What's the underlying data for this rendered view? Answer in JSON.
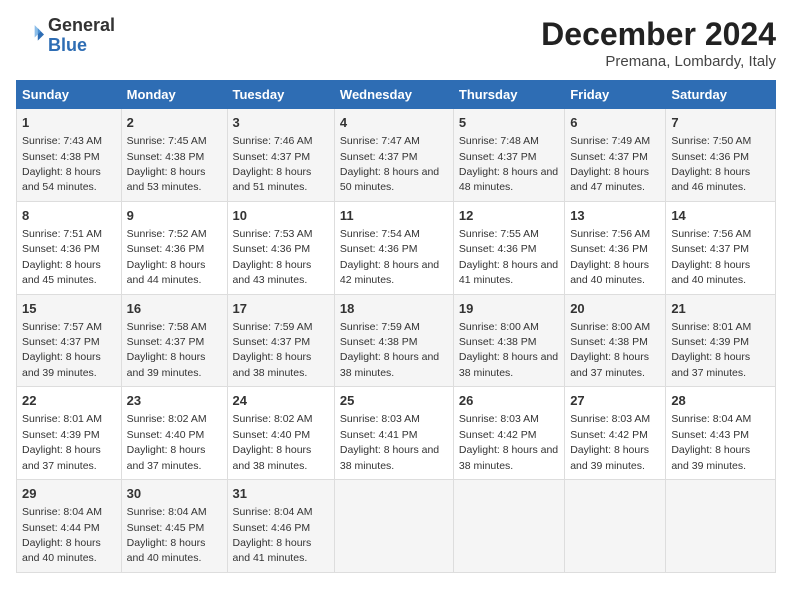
{
  "header": {
    "logo_general": "General",
    "logo_blue": "Blue",
    "month_title": "December 2024",
    "location": "Premana, Lombardy, Italy"
  },
  "weekdays": [
    "Sunday",
    "Monday",
    "Tuesday",
    "Wednesday",
    "Thursday",
    "Friday",
    "Saturday"
  ],
  "weeks": [
    [
      {
        "day": "1",
        "sunrise": "Sunrise: 7:43 AM",
        "sunset": "Sunset: 4:38 PM",
        "daylight": "Daylight: 8 hours and 54 minutes."
      },
      {
        "day": "2",
        "sunrise": "Sunrise: 7:45 AM",
        "sunset": "Sunset: 4:38 PM",
        "daylight": "Daylight: 8 hours and 53 minutes."
      },
      {
        "day": "3",
        "sunrise": "Sunrise: 7:46 AM",
        "sunset": "Sunset: 4:37 PM",
        "daylight": "Daylight: 8 hours and 51 minutes."
      },
      {
        "day": "4",
        "sunrise": "Sunrise: 7:47 AM",
        "sunset": "Sunset: 4:37 PM",
        "daylight": "Daylight: 8 hours and 50 minutes."
      },
      {
        "day": "5",
        "sunrise": "Sunrise: 7:48 AM",
        "sunset": "Sunset: 4:37 PM",
        "daylight": "Daylight: 8 hours and 48 minutes."
      },
      {
        "day": "6",
        "sunrise": "Sunrise: 7:49 AM",
        "sunset": "Sunset: 4:37 PM",
        "daylight": "Daylight: 8 hours and 47 minutes."
      },
      {
        "day": "7",
        "sunrise": "Sunrise: 7:50 AM",
        "sunset": "Sunset: 4:36 PM",
        "daylight": "Daylight: 8 hours and 46 minutes."
      }
    ],
    [
      {
        "day": "8",
        "sunrise": "Sunrise: 7:51 AM",
        "sunset": "Sunset: 4:36 PM",
        "daylight": "Daylight: 8 hours and 45 minutes."
      },
      {
        "day": "9",
        "sunrise": "Sunrise: 7:52 AM",
        "sunset": "Sunset: 4:36 PM",
        "daylight": "Daylight: 8 hours and 44 minutes."
      },
      {
        "day": "10",
        "sunrise": "Sunrise: 7:53 AM",
        "sunset": "Sunset: 4:36 PM",
        "daylight": "Daylight: 8 hours and 43 minutes."
      },
      {
        "day": "11",
        "sunrise": "Sunrise: 7:54 AM",
        "sunset": "Sunset: 4:36 PM",
        "daylight": "Daylight: 8 hours and 42 minutes."
      },
      {
        "day": "12",
        "sunrise": "Sunrise: 7:55 AM",
        "sunset": "Sunset: 4:36 PM",
        "daylight": "Daylight: 8 hours and 41 minutes."
      },
      {
        "day": "13",
        "sunrise": "Sunrise: 7:56 AM",
        "sunset": "Sunset: 4:36 PM",
        "daylight": "Daylight: 8 hours and 40 minutes."
      },
      {
        "day": "14",
        "sunrise": "Sunrise: 7:56 AM",
        "sunset": "Sunset: 4:37 PM",
        "daylight": "Daylight: 8 hours and 40 minutes."
      }
    ],
    [
      {
        "day": "15",
        "sunrise": "Sunrise: 7:57 AM",
        "sunset": "Sunset: 4:37 PM",
        "daylight": "Daylight: 8 hours and 39 minutes."
      },
      {
        "day": "16",
        "sunrise": "Sunrise: 7:58 AM",
        "sunset": "Sunset: 4:37 PM",
        "daylight": "Daylight: 8 hours and 39 minutes."
      },
      {
        "day": "17",
        "sunrise": "Sunrise: 7:59 AM",
        "sunset": "Sunset: 4:37 PM",
        "daylight": "Daylight: 8 hours and 38 minutes."
      },
      {
        "day": "18",
        "sunrise": "Sunrise: 7:59 AM",
        "sunset": "Sunset: 4:38 PM",
        "daylight": "Daylight: 8 hours and 38 minutes."
      },
      {
        "day": "19",
        "sunrise": "Sunrise: 8:00 AM",
        "sunset": "Sunset: 4:38 PM",
        "daylight": "Daylight: 8 hours and 38 minutes."
      },
      {
        "day": "20",
        "sunrise": "Sunrise: 8:00 AM",
        "sunset": "Sunset: 4:38 PM",
        "daylight": "Daylight: 8 hours and 37 minutes."
      },
      {
        "day": "21",
        "sunrise": "Sunrise: 8:01 AM",
        "sunset": "Sunset: 4:39 PM",
        "daylight": "Daylight: 8 hours and 37 minutes."
      }
    ],
    [
      {
        "day": "22",
        "sunrise": "Sunrise: 8:01 AM",
        "sunset": "Sunset: 4:39 PM",
        "daylight": "Daylight: 8 hours and 37 minutes."
      },
      {
        "day": "23",
        "sunrise": "Sunrise: 8:02 AM",
        "sunset": "Sunset: 4:40 PM",
        "daylight": "Daylight: 8 hours and 37 minutes."
      },
      {
        "day": "24",
        "sunrise": "Sunrise: 8:02 AM",
        "sunset": "Sunset: 4:40 PM",
        "daylight": "Daylight: 8 hours and 38 minutes."
      },
      {
        "day": "25",
        "sunrise": "Sunrise: 8:03 AM",
        "sunset": "Sunset: 4:41 PM",
        "daylight": "Daylight: 8 hours and 38 minutes."
      },
      {
        "day": "26",
        "sunrise": "Sunrise: 8:03 AM",
        "sunset": "Sunset: 4:42 PM",
        "daylight": "Daylight: 8 hours and 38 minutes."
      },
      {
        "day": "27",
        "sunrise": "Sunrise: 8:03 AM",
        "sunset": "Sunset: 4:42 PM",
        "daylight": "Daylight: 8 hours and 39 minutes."
      },
      {
        "day": "28",
        "sunrise": "Sunrise: 8:04 AM",
        "sunset": "Sunset: 4:43 PM",
        "daylight": "Daylight: 8 hours and 39 minutes."
      }
    ],
    [
      {
        "day": "29",
        "sunrise": "Sunrise: 8:04 AM",
        "sunset": "Sunset: 4:44 PM",
        "daylight": "Daylight: 8 hours and 40 minutes."
      },
      {
        "day": "30",
        "sunrise": "Sunrise: 8:04 AM",
        "sunset": "Sunset: 4:45 PM",
        "daylight": "Daylight: 8 hours and 40 minutes."
      },
      {
        "day": "31",
        "sunrise": "Sunrise: 8:04 AM",
        "sunset": "Sunset: 4:46 PM",
        "daylight": "Daylight: 8 hours and 41 minutes."
      },
      null,
      null,
      null,
      null
    ]
  ]
}
